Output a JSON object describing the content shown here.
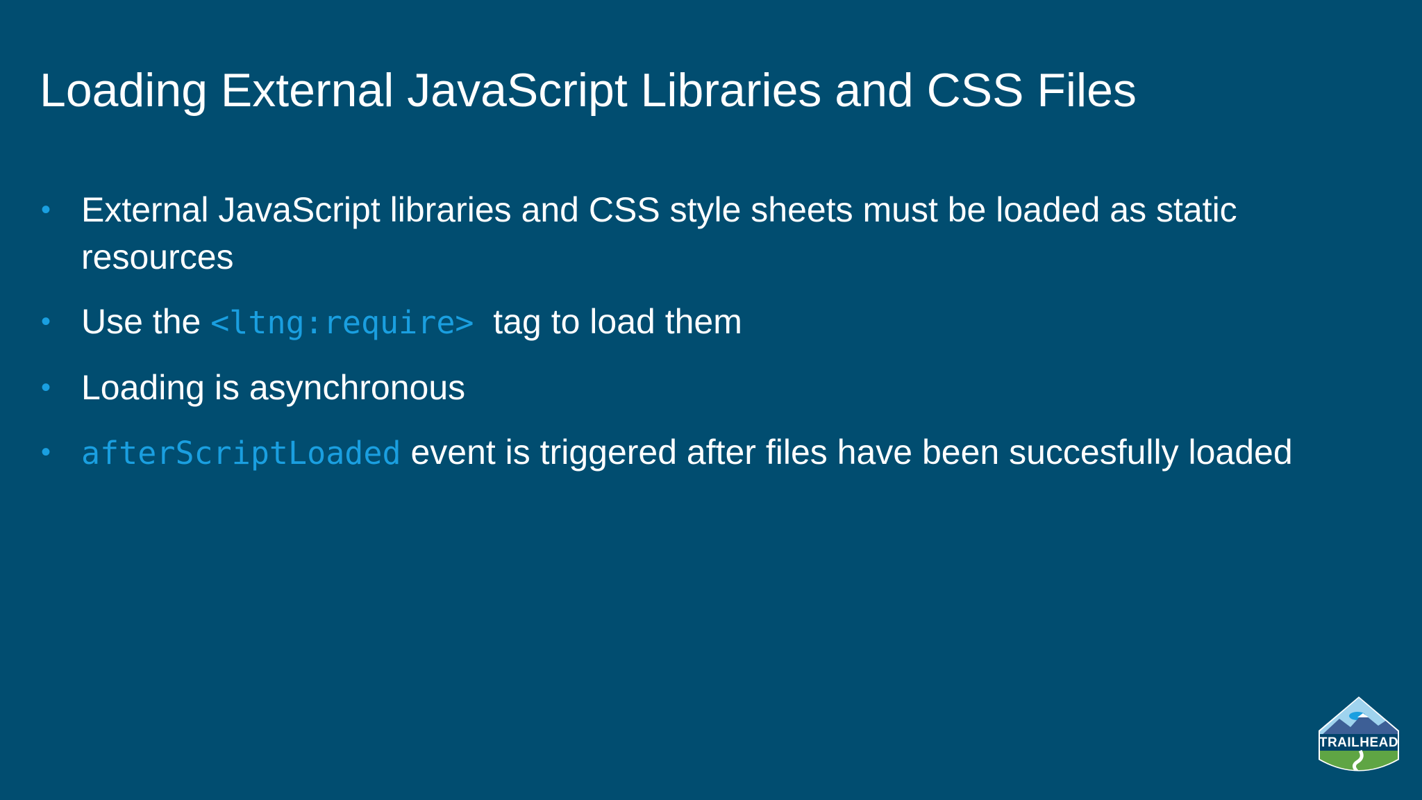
{
  "slide": {
    "title": "Loading External JavaScript Libraries and CSS Files",
    "bullets": [
      {
        "text": "External JavaScript libraries and CSS style sheets must be loaded as static resources"
      },
      {
        "prefix": "Use the ",
        "code": "<ltng:require>",
        "suffix": "  tag to load them"
      },
      {
        "text": "Loading is asynchronous"
      },
      {
        "code": "afterScriptLoaded",
        "suffix": " event is triggered after files have been succesfully loaded"
      }
    ],
    "bullet_glyph": "•"
  },
  "logo": {
    "text": "TRAILHEAD",
    "icon": "trailhead-badge-icon"
  },
  "colors": {
    "background": "#014d70",
    "accent": "#1a9fe0",
    "text": "#ffffff"
  }
}
